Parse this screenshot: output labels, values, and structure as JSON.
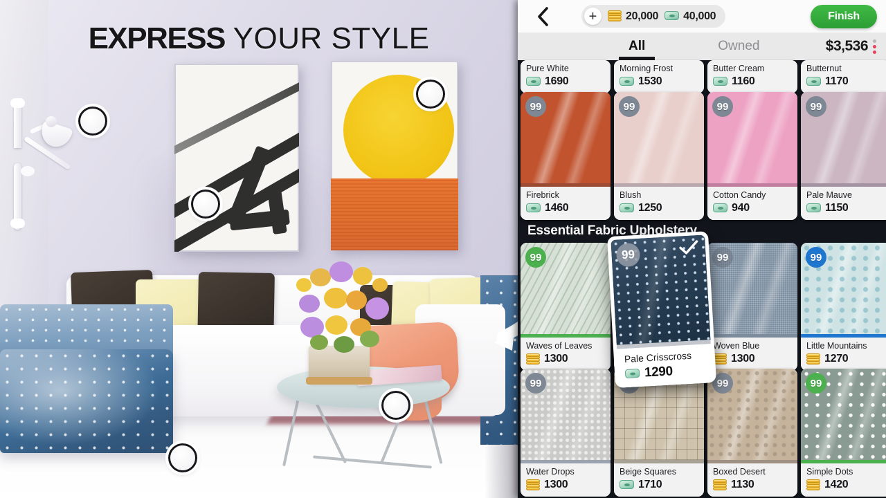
{
  "headline": {
    "bold": "EXPRESS",
    "light": "YOUR STYLE"
  },
  "topbar": {
    "back_icon": "chevron-left-icon",
    "add_label": "+",
    "coin_icon": "coin-stack-icon",
    "coin_amount": "20,000",
    "cash_icon": "cash-bundle-icon",
    "cash_amount": "40,000",
    "finish_label": "Finish"
  },
  "tabs": [
    {
      "label": "All",
      "active": true
    },
    {
      "label": "Owned",
      "active": false
    }
  ],
  "price_total": "$3,536",
  "kebab_icon": "more-options-icon",
  "sections": [
    {
      "title": "",
      "rows": [
        {
          "type": "labels_only",
          "items": [
            {
              "name": "Pure White",
              "price": "1690",
              "currency": "cash"
            },
            {
              "name": "Morning Frost",
              "price": "1530",
              "currency": "cash"
            },
            {
              "name": "Butter Cream",
              "price": "1160",
              "currency": "cash"
            },
            {
              "name": "Butternut",
              "price": "1170",
              "currency": "cash"
            }
          ]
        },
        {
          "type": "tiles",
          "items": [
            {
              "name": "Firebrick",
              "price": "1460",
              "currency": "cash",
              "badge": "99",
              "badge_style": "plain",
              "color": "#c1542f",
              "accent": "#9b4a34"
            },
            {
              "name": "Blush",
              "price": "1250",
              "currency": "cash",
              "badge": "99",
              "badge_style": "plain",
              "color": "#e8cfcb",
              "accent": "#b9a7ae"
            },
            {
              "name": "Cotton Candy",
              "price": "940",
              "currency": "cash",
              "badge": "99",
              "badge_style": "plain",
              "color": "#eda2c3",
              "accent": "#c07f9f"
            },
            {
              "name": "Pale Mauve",
              "price": "1150",
              "currency": "cash",
              "badge": "99",
              "badge_style": "plain",
              "color": "#cbb6c2",
              "accent": "#a494a3"
            }
          ]
        }
      ]
    },
    {
      "title": "Essential Fabric Upholstery",
      "rows": [
        {
          "type": "tiles",
          "items": [
            {
              "name": "Waves of Leaves",
              "price": "1300",
              "currency": "coin",
              "badge": "99",
              "badge_style": "green",
              "color": "#cdd9cc",
              "accent": "#4cb04f",
              "pattern": "leaves"
            },
            {
              "name": "Pale Crisscross",
              "price": "1290",
              "currency": "cash",
              "badge": "99",
              "badge_style": "faint",
              "color": "#2b4258",
              "accent": "#c3c7cd",
              "pattern": "triangles",
              "obscured": true
            },
            {
              "name": "Woven Blue",
              "price": "1300",
              "currency": "coin",
              "badge": "99",
              "badge_style": "faint",
              "color": "#8c9fb2",
              "accent": "#7c8c9c",
              "pattern": "woven"
            },
            {
              "name": "Little Mountains",
              "price": "1270",
              "currency": "coin",
              "badge": "99",
              "badge_style": "blue",
              "color": "#cfe3e4",
              "accent": "#1f76cf",
              "pattern": "triangles-lt"
            }
          ]
        },
        {
          "type": "tiles",
          "items": [
            {
              "name": "Water Drops",
              "price": "1300",
              "currency": "coin",
              "badge": "99",
              "badge_style": "plain",
              "color": "#d6d6d3",
              "accent": "#9aa3ae",
              "pattern": "drops"
            },
            {
              "name": "Beige Squares",
              "price": "1710",
              "currency": "cash",
              "badge": "99",
              "badge_style": "plain",
              "color": "#cfc3ad",
              "accent": "#a7a295",
              "pattern": "squares"
            },
            {
              "name": "Boxed Desert",
              "price": "1130",
              "currency": "coin",
              "badge": "99",
              "badge_style": "plain",
              "color": "#c5b39c",
              "accent": "#9e9184",
              "pattern": "boxes"
            },
            {
              "name": "Simple Dots",
              "price": "1420",
              "currency": "coin",
              "badge": "99",
              "badge_style": "green",
              "color": "#8a9b93",
              "accent": "#4cb04f",
              "pattern": "dots"
            }
          ]
        }
      ]
    }
  ],
  "floating_card": {
    "name": "Pale Crisscross",
    "price": "1290",
    "currency": "cash",
    "badge": "99",
    "check_icon": "checkmark-icon"
  },
  "scene": {
    "hint_arrow_icon": "curved-arrow-icon",
    "hotspot_icon": "hotspot-marker-icon",
    "hotspots": 6
  },
  "colors": {
    "accent_green": "#2d9e34",
    "accent_blue": "#1f76cf",
    "badge_green": "#4cb04f",
    "panel_bg": "#12161c",
    "price_red": "#e8415a"
  }
}
